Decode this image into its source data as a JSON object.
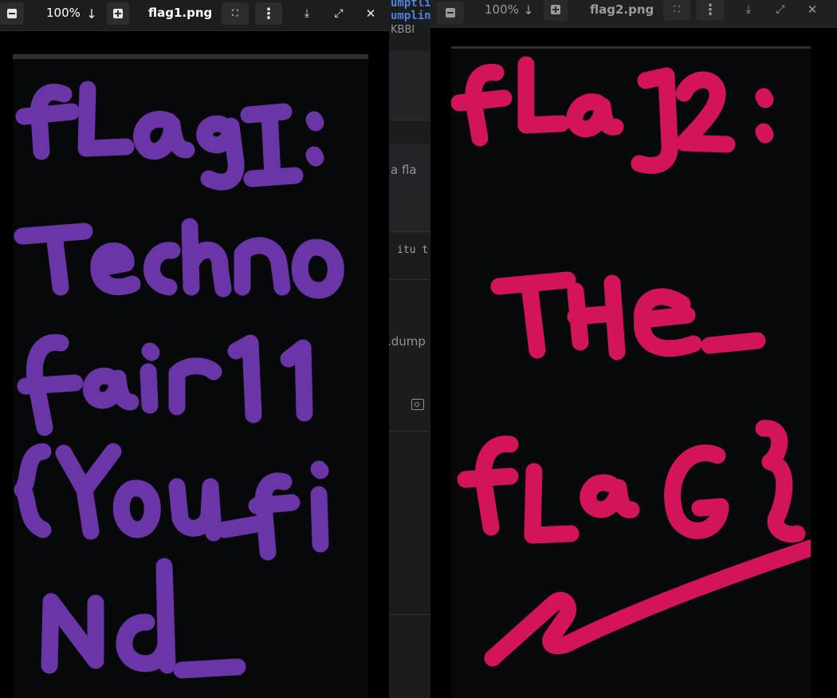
{
  "background_editor": {
    "code_line_1": "umptlin",
    "code_line_2": "umplin",
    "label_kbbi": "KBBI",
    "text_fla": "a fla",
    "text_itu": "itu t",
    "text_dump": ".dump"
  },
  "viewer1": {
    "zoom": "100%",
    "filename": "flag1.png",
    "drawing_text": "flag1: TechnoFair11{You_find_",
    "ink_color": "#6a35a6"
  },
  "viewer2": {
    "zoom": "100%",
    "filename": "flag2.png",
    "drawing_text": "flag2: THE_fLaG}",
    "ink_color": "#d4145a"
  },
  "icons": {
    "zoom_out": "minus-square-icon",
    "zoom_in": "plus-square-icon",
    "zoom_dropdown": "chevron-down-icon",
    "fit": "fit-screen-icon",
    "menu": "kebab-menu-icon",
    "download": "download-icon",
    "fullscreen": "expand-icon",
    "close": "close-icon"
  }
}
